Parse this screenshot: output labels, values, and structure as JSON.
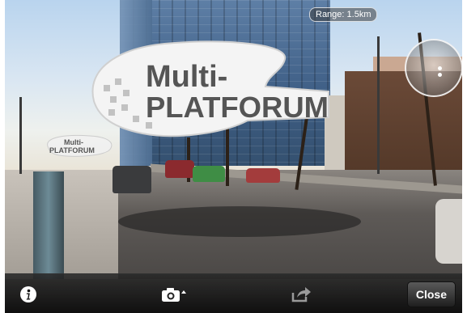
{
  "ar_view": {
    "range_label": "Range: 1.5km",
    "poi_marker_large": {
      "line1": "Multi-",
      "line2": "PLATFORUM"
    },
    "poi_marker_small": {
      "line1": "Multi-",
      "line2": "PLATFORUM"
    }
  },
  "toolbar": {
    "info_icon": "info-icon",
    "camera_icon": "camera-icon",
    "share_icon": "share-icon",
    "close_label": "Close"
  },
  "colors": {
    "toolbar_bg": "#141414",
    "bubble_fill": "#f4f4f4",
    "bubble_text": "#555555",
    "bubble_accent": "#bdbdbd"
  }
}
